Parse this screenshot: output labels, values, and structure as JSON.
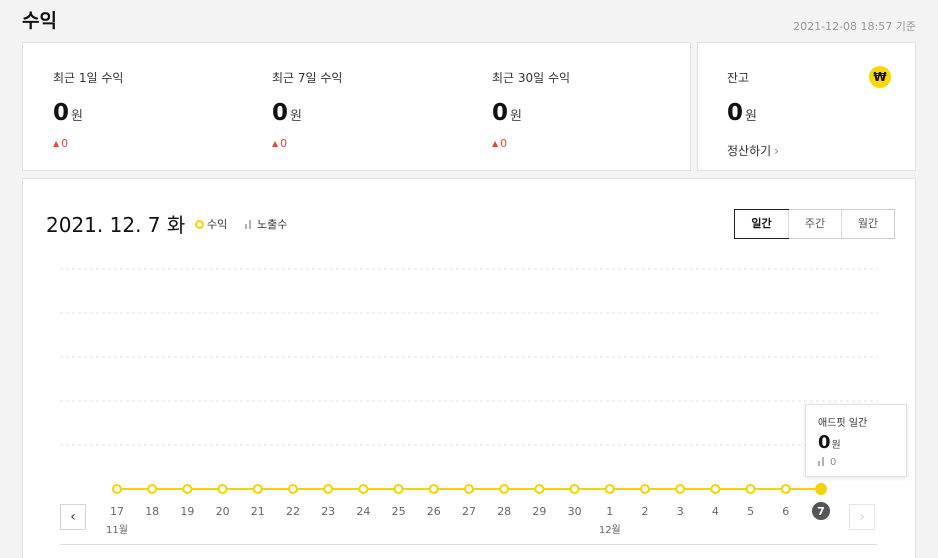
{
  "page": {
    "title": "수익",
    "timestamp": "2021-12-08 18:57 기준"
  },
  "stats": [
    {
      "label": "최근 1일 수익",
      "value": "0",
      "unit": "원",
      "change_arrow": "▲",
      "change": "0"
    },
    {
      "label": "최근 7일 수익",
      "value": "0",
      "unit": "원",
      "change_arrow": "▲",
      "change": "0"
    },
    {
      "label": "최근 30일 수익",
      "value": "0",
      "unit": "원",
      "change_arrow": "▲",
      "change": "0"
    }
  ],
  "balance": {
    "label": "잔고",
    "value": "0",
    "unit": "원",
    "settle_label": "정산하기",
    "settle_chevron": "›",
    "icon": "won-icon",
    "icon_glyph": "₩"
  },
  "chart_header": {
    "date_label": "2021. 12. 7 화",
    "legend": {
      "revenue": "수익",
      "impressions": "노출수"
    },
    "tabs": [
      {
        "label": "일간",
        "active": true
      },
      {
        "label": "주간",
        "active": false
      },
      {
        "label": "월간",
        "active": false
      }
    ]
  },
  "tooltip": {
    "title": "애드핏 일간",
    "value": "0",
    "unit": "원",
    "impressions": "0"
  },
  "nav": {
    "prev": "‹",
    "next": "›"
  },
  "colors": {
    "revenue_line": "#f4d400",
    "impression_bar": "#aab4c0",
    "selected_day": "#555555",
    "change_up": "#e8453c"
  },
  "chart_data": {
    "type": "line",
    "x": [
      "17",
      "18",
      "19",
      "20",
      "21",
      "22",
      "23",
      "24",
      "25",
      "26",
      "27",
      "28",
      "29",
      "30",
      "1",
      "2",
      "3",
      "4",
      "5",
      "6",
      "7"
    ],
    "month_labels": [
      {
        "index": 0,
        "label": "11월"
      },
      {
        "index": 14,
        "label": "12월"
      }
    ],
    "series": [
      {
        "name": "수익",
        "values": [
          0,
          0,
          0,
          0,
          0,
          0,
          0,
          0,
          0,
          0,
          0,
          0,
          0,
          0,
          0,
          0,
          0,
          0,
          0,
          0,
          0
        ]
      },
      {
        "name": "노출수",
        "values": [
          0,
          0,
          0,
          0,
          0,
          0,
          0,
          0,
          0,
          0,
          0,
          0,
          0,
          0,
          0,
          0,
          0,
          0,
          0,
          0,
          0
        ]
      }
    ],
    "selected_index": 20,
    "grid": true
  }
}
